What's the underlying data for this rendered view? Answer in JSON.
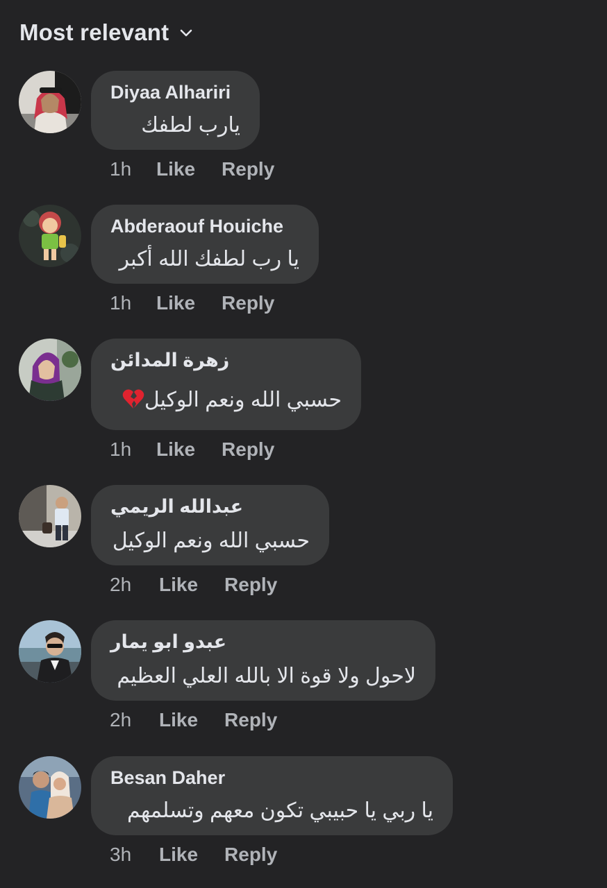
{
  "header": {
    "sort_label": "Most relevant"
  },
  "actions": {
    "like": "Like",
    "reply": "Reply"
  },
  "comments": [
    {
      "author": "Diyaa Alhariri",
      "text": "يارب لطفك",
      "time": "1h"
    },
    {
      "author": "Abderaouf Houiche",
      "text": "يا رب لطفك الله أكبر",
      "time": "1h"
    },
    {
      "author": "زهرة المدائن",
      "text": "حسبي الله ونعم الوكيل",
      "emoji": "💔",
      "time": "1h"
    },
    {
      "author": "عبدالله الريمي",
      "text": "حسبي الله ونعم الوكيل",
      "time": "2h"
    },
    {
      "author": "عبدو ابو يمار",
      "text": "لاحول ولا قوة الا بالله العلي العظيم",
      "time": "2h"
    },
    {
      "author": "Besan Daher",
      "text": "يا ربي يا حبيبي تكون معهم وتسلمهم",
      "time": "3h"
    }
  ]
}
